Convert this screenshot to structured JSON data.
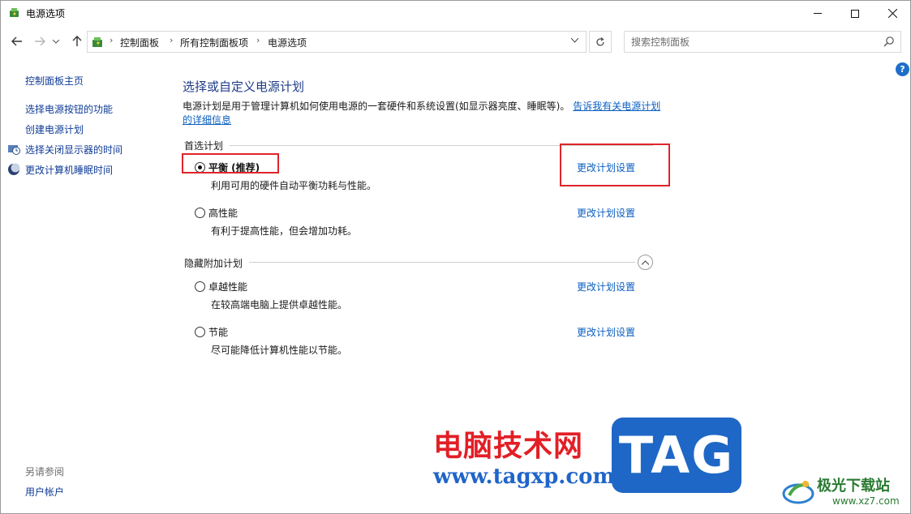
{
  "window": {
    "title": "电源选项"
  },
  "address": {
    "crumbs": [
      "控制面板",
      "所有控制面板项",
      "电源选项"
    ],
    "search_placeholder": "搜索控制面板"
  },
  "leftnav": {
    "home": "控制面板主页",
    "links": [
      "选择电源按钮的功能",
      "创建电源计划",
      "选择关闭显示器的时间",
      "更改计算机睡眠时间"
    ],
    "see_also_label": "另请参阅",
    "see_also_links": [
      "用户帐户"
    ]
  },
  "main": {
    "title": "选择或自定义电源计划",
    "description": "电源计划是用于管理计算机如何使用电源的一套硬件和系统设置(如显示器亮度、睡眠等)。",
    "description_link": "告诉我有关电源计划的详细信息",
    "preferred_header": "首选计划",
    "hidden_header": "隐藏附加计划",
    "change_link": "更改计划设置",
    "plans": [
      {
        "name": "平衡 (推荐)",
        "desc": "利用可用的硬件自动平衡功耗与性能。",
        "selected": true
      },
      {
        "name": "高性能",
        "desc": "有利于提高性能，但会增加功耗。",
        "selected": false
      },
      {
        "name": "卓越性能",
        "desc": "在较高端电脑上提供卓越性能。",
        "selected": false
      },
      {
        "name": "节能",
        "desc": "尽可能降低计算机性能以节能。",
        "selected": false
      }
    ]
  },
  "watermark": {
    "site_cn": "电脑技术网",
    "site_url": "www.tagxp.com",
    "badge": "TAG",
    "site2_cn": "极光下载站",
    "site2_url": "www.xz7.com"
  },
  "colors": {
    "link": "#0b5fc0",
    "highlight": "#e0242b",
    "title": "#1f3c88"
  }
}
